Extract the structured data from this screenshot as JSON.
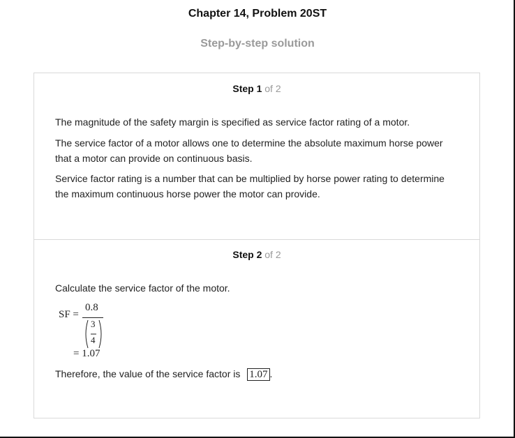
{
  "header": {
    "title": "Chapter 14, Problem 20ST",
    "subtitle": "Step-by-step solution"
  },
  "steps": [
    {
      "label": "Step 1",
      "of": " of 2",
      "paragraphs": [
        "The magnitude of the safety margin is specified as service factor rating of a motor.",
        "The service factor of a motor allows one to determine the absolute maximum horse power that a motor can provide on continuous basis.",
        "Service factor rating is a number that can be multiplied by horse power rating to determine the maximum continuous horse power the motor can provide."
      ]
    },
    {
      "label": "Step 2",
      "of": " of 2",
      "intro": "Calculate the service factor of the motor.",
      "equation": {
        "lhs": "SF =",
        "numerator": "0.8",
        "inner_numerator": "3",
        "inner_denominator": "4",
        "result": "= 1.07"
      },
      "conclusion_prefix": "Therefore, the value of the service factor is",
      "boxed_value": "1.07",
      "conclusion_suffix": "."
    }
  ]
}
